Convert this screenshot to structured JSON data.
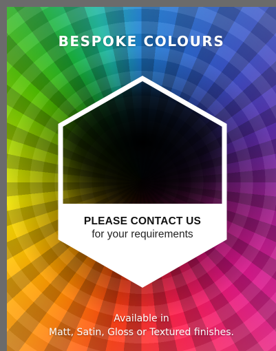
{
  "banner": {
    "title": "BESPOKE COLOURS",
    "contact_heading": "PLEASE CONTACT US",
    "contact_subtext": "for your requirements",
    "availability_line1": "Available in",
    "availability_line2": "Matt, Satin, Gloss or Textured finishes."
  },
  "colors": {
    "frame": "#6b6b6b",
    "text_light": "#ffffff",
    "text_dark": "#111111",
    "hexagon_fill": "#ffffff"
  },
  "icons": [
    "colour-wheel-graphic",
    "hexagon-badge"
  ]
}
